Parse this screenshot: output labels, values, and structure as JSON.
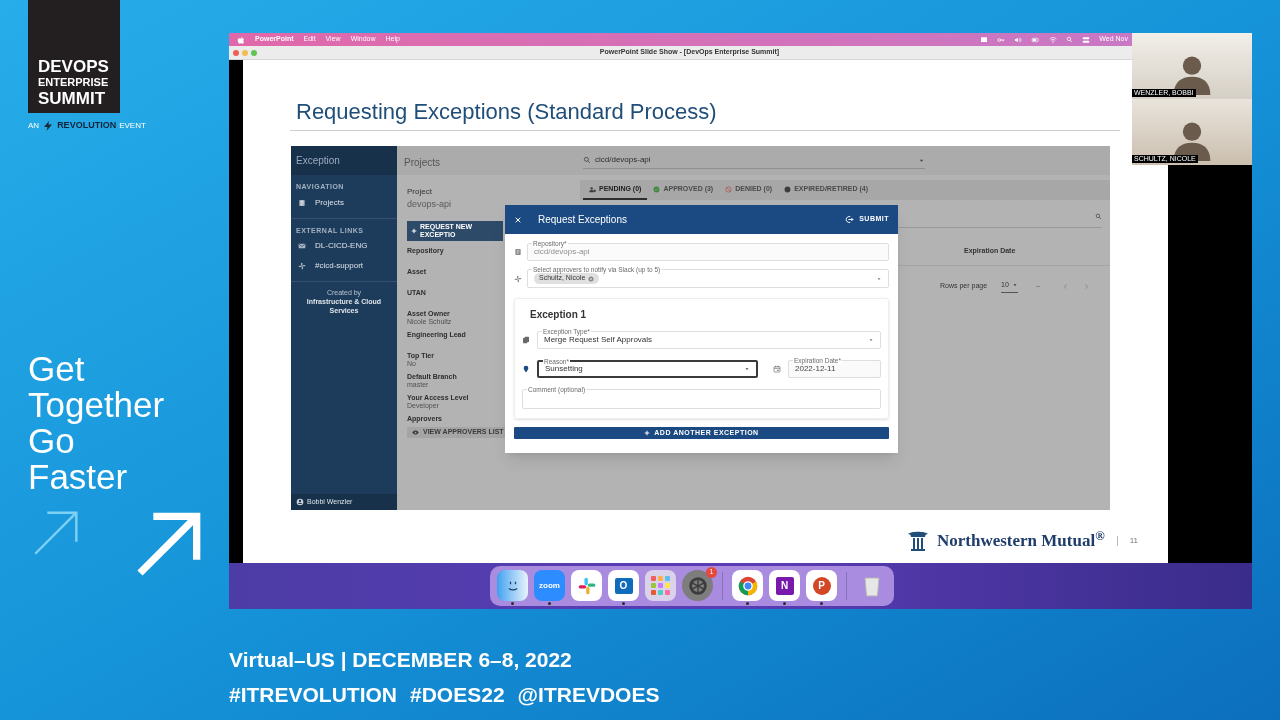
{
  "event": {
    "logo": [
      "DEVOPS",
      "ENTERPRISE",
      "SUMMIT"
    ],
    "byline": {
      "prefix": "AN",
      "brand": "REVOLUTION",
      "suffix": "EVENT"
    },
    "slogan": [
      "Get",
      "Together",
      "Go",
      "Faster"
    ],
    "dates": "Virtual–US | DECEMBER 6–8, 2022",
    "tags": [
      "#ITREVOLUTION",
      "#DOES22",
      "@ITREVDOES"
    ]
  },
  "menu_bar": {
    "items": [
      {
        "label": "PowerPoint",
        "kind": "app"
      },
      {
        "label": "Edit",
        "kind": "menu"
      },
      {
        "label": "View",
        "kind": "menu"
      },
      {
        "label": "Window",
        "kind": "menu"
      },
      {
        "label": "Help",
        "kind": "menu"
      }
    ],
    "clock": "Wed Nov"
  },
  "window": {
    "title": "PowerPoint Slide Show - [DevOps Enterprise Summit]"
  },
  "slide": {
    "title": "Requesting Exceptions (Standard Process)",
    "company": "Northwestern Mutual$^{®}$",
    "page": "11",
    "app": {
      "sidebar": {
        "title": "Exception",
        "sections": [
          {
            "heading": "NAVIGATION",
            "items": [
              {
                "label": "Projects"
              }
            ]
          },
          {
            "heading": "EXTERNAL LINKS",
            "items": [
              {
                "label": "DL-CICD-ENG"
              },
              {
                "label": "#cicd-support"
              }
            ]
          }
        ],
        "credit": {
          "caption": "Created by",
          "team": "Infrastructure & Cloud Services"
        },
        "user": "Bobbi Wenzler"
      },
      "header": {
        "title": "Projects",
        "search": "cicd/devops-api"
      },
      "project": {
        "label": "Project",
        "name": "devops-api",
        "request_button": "REQUEST NEW EXCEPTIO",
        "details": [
          {
            "label": "Repository"
          },
          {
            "label": "Asset"
          },
          {
            "label": "UTAN"
          },
          {
            "label": "Asset Owner",
            "value": "Nicole Schultz"
          },
          {
            "label": "Engineering Lead"
          },
          {
            "label": "Top Tier",
            "value": "No"
          },
          {
            "label": "Default Branch",
            "value": "master"
          },
          {
            "label": "Your Access Level",
            "value": "Developer"
          },
          {
            "label": "Approvers"
          }
        ],
        "approvers_button": "VIEW APPROVERS LIST"
      },
      "tabs": [
        {
          "label": "PENDING (0)",
          "selected": true
        },
        {
          "label": "APPROVED (3)",
          "selected": false
        },
        {
          "label": "DENIED (0)",
          "selected": false
        },
        {
          "label": "EXPIRED/RETIRED (4)",
          "selected": false
        }
      ],
      "table": {
        "columns": [
          "Expiration Date"
        ],
        "rows_per_page_label": "Rows per page",
        "rows_per_page": "10"
      },
      "dialog": {
        "title": "Request Exceptions",
        "submit": "SUBMIT",
        "fields": [
          {
            "kind": "text",
            "label": "Repository*",
            "value": "cicd/devops-api",
            "disabled": true
          },
          {
            "kind": "chips",
            "label": "Select approvers to notify via Slack (up to 5)",
            "chips": [
              "Schultz, Nicole"
            ],
            "disabled": false
          }
        ],
        "exceptions": [
          {
            "heading": "Exception 1",
            "type": {
              "label": "Exception Type*",
              "value": "Merge Request Self Approvals"
            },
            "reason": {
              "label": "Reason*",
              "value": "Sunsetting",
              "focused": true
            },
            "expiration": {
              "label": "Expiration Date*",
              "value": "2022-12-11"
            },
            "comment": {
              "label": "Comment (optional)"
            }
          }
        ],
        "add_button": "ADD ANOTHER EXCEPTION"
      }
    }
  },
  "dock": {
    "items": [
      {
        "kind": "finder",
        "running": true
      },
      {
        "kind": "zoom",
        "label": "zoom",
        "running": true
      },
      {
        "kind": "slack",
        "running": false
      },
      {
        "kind": "outlook",
        "glyph": "O",
        "running": true
      },
      {
        "kind": "launchpad",
        "running": false
      },
      {
        "kind": "settings",
        "badge": "1",
        "running": false
      },
      {
        "kind": "separator"
      },
      {
        "kind": "chrome",
        "running": true
      },
      {
        "kind": "onenote",
        "glyph": "N",
        "running": true
      },
      {
        "kind": "powerpoint",
        "glyph": "P",
        "running": true
      },
      {
        "kind": "separator"
      },
      {
        "kind": "trash",
        "running": false
      }
    ]
  },
  "participants": [
    {
      "name": "WENZLER, BOBBI"
    },
    {
      "name": "SCHULTZ, NICOLE"
    }
  ]
}
